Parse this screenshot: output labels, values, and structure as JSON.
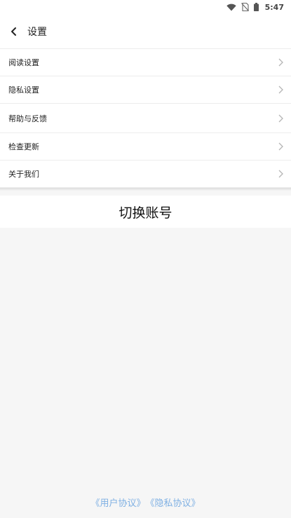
{
  "status_bar": {
    "time": "5:47",
    "icons": [
      "wifi-icon",
      "no-sim-icon",
      "battery-icon"
    ]
  },
  "header": {
    "title": "设置",
    "back_icon": "chevron-left-icon"
  },
  "settings": {
    "items": [
      {
        "label": "阅读设置"
      },
      {
        "label": "隐私设置"
      },
      {
        "label": "帮助与反馈"
      },
      {
        "label": "检查更新"
      },
      {
        "label": "关于我们"
      }
    ],
    "chevron_icon": "chevron-right-icon"
  },
  "switch_account": {
    "label": "切换账号"
  },
  "footer": {
    "user_agreement": "《用户协议》",
    "privacy_agreement": "《隐私协议》"
  },
  "colors": {
    "background": "#f6f6f6",
    "surface": "#ffffff",
    "divider": "#ececec",
    "link": "#7fb0e3"
  }
}
